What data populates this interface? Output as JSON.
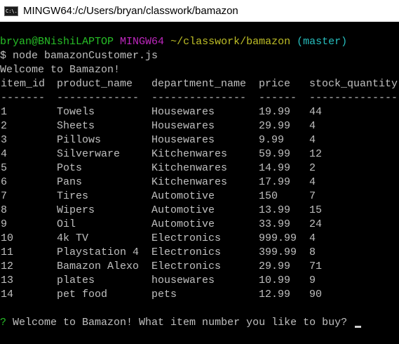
{
  "window": {
    "title": "MINGW64:/c/Users/bryan/classwork/bamazon",
    "icon": "terminal-icon",
    "icon_text": "C:\\."
  },
  "prompt": {
    "user_host": "bryan@BNishiLAPTOP",
    "shell": "MINGW64",
    "path": "~/classwork/bamazon",
    "branch": "(master)"
  },
  "command": "$ node bamazonCustomer.js",
  "welcome": "Welcome to Bamazon!",
  "table": {
    "headers": [
      "item_id",
      "product_name",
      "department_name",
      "price",
      "stock_quantity"
    ],
    "separators": [
      "-------",
      "-------------",
      "---------------",
      "------",
      "--------------"
    ],
    "rows": [
      [
        "1",
        "Towels",
        "Housewares",
        "19.99",
        "44"
      ],
      [
        "2",
        "Sheets",
        "Housewares",
        "29.99",
        "4"
      ],
      [
        "3",
        "Pillows",
        "Housewares",
        "9.99",
        "4"
      ],
      [
        "4",
        "Silverware",
        "Kitchenwares",
        "59.99",
        "12"
      ],
      [
        "5",
        "Pots",
        "Kitchenwares",
        "14.99",
        "2"
      ],
      [
        "6",
        "Pans",
        "Kitchenwares",
        "17.99",
        "4"
      ],
      [
        "7",
        "Tires",
        "Automotive",
        "150",
        "7"
      ],
      [
        "8",
        "Wipers",
        "Automotive",
        "13.99",
        "15"
      ],
      [
        "9",
        "Oil",
        "Automotive",
        "33.99",
        "24"
      ],
      [
        "10",
        "4k TV",
        "Electronics",
        "999.99",
        "4"
      ],
      [
        "11",
        "Playstation 4",
        "Electronics",
        "399.99",
        "8"
      ],
      [
        "12",
        "Bamazon Alexo",
        "Electronics",
        "29.99",
        "71"
      ],
      [
        "13",
        "plates",
        "housewares",
        "10.99",
        "9"
      ],
      [
        "14",
        "pet food",
        "pets",
        "12.99",
        "90"
      ]
    ]
  },
  "question": {
    "mark": "?",
    "text": " Welcome to Bamazon! What item number you like to buy? "
  },
  "colors": {
    "background": "#000000",
    "text": "#c0c0c0",
    "user_host": "#27bf27",
    "shell": "#bf27bf",
    "path": "#bfbf27",
    "branch": "#27bfbf"
  }
}
